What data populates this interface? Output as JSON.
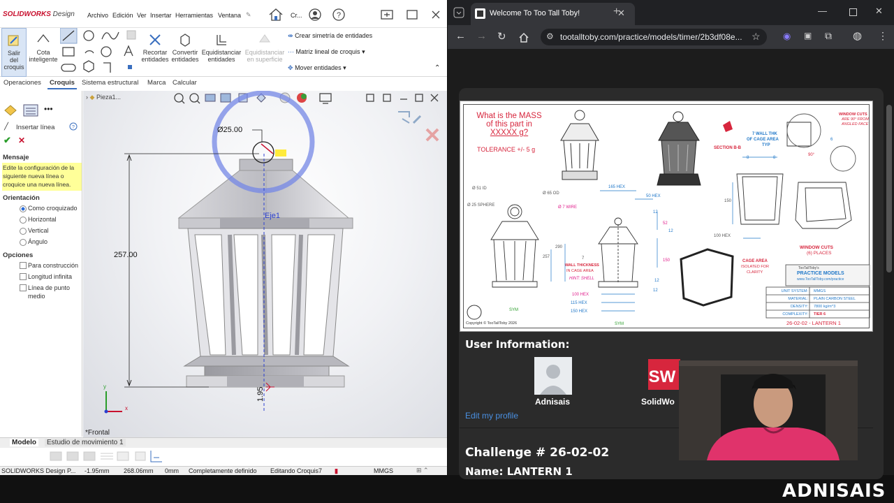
{
  "solidworks": {
    "brand_sw": "SOLIDWORKS",
    "brand_design": "Design",
    "menu": [
      "Archivo",
      "Edición",
      "Ver",
      "Insertar",
      "Herramientas",
      "Ventana"
    ],
    "title_short": "Cr...",
    "ribbon": {
      "exit_sketch": [
        "Salir",
        "del",
        "croquis"
      ],
      "smart_dim": [
        "Cota",
        "inteligente"
      ],
      "trim": [
        "Recortar",
        "entidades"
      ],
      "convert": [
        "Convertir",
        "entidades"
      ],
      "offset": [
        "Equidistanciar",
        "entidades"
      ],
      "offset_surface": [
        "Equidistanciar",
        "en superficie"
      ],
      "mirror": "Crear simetría de entidades",
      "linear_pattern": "Matriz lineal de croquis",
      "move": "Mover entidades"
    },
    "tabs": [
      "Operaciones",
      "Croquis",
      "Sistema estructural",
      "Marca",
      "Calcular"
    ],
    "active_tab": "Croquis",
    "tree_item": "Pieza1...",
    "panel": {
      "title": "Insertar línea",
      "message_header": "Mensaje",
      "message": "Edite la configuración de la siguiente nueva línea o croquice una nueva línea.",
      "orientation_header": "Orientación",
      "orientation": [
        "Como croquizado",
        "Horizontal",
        "Vertical",
        "Ángulo"
      ],
      "orientation_selected": "Como croquizado",
      "options_header": "Opciones",
      "options": [
        "Para construcción",
        "Longitud infinita",
        "Línea de punto medio"
      ]
    },
    "viewport": {
      "dim_diameter": "Ø25.00",
      "dim_height": "257.00",
      "dim_offset": "1.95",
      "axis_label": "Eje1",
      "view_name": "*Frontal",
      "triad_x": "x",
      "triad_y": "y"
    },
    "bottom_tabs": [
      "Modelo",
      "Estudio de movimiento 1"
    ],
    "status": {
      "app": "SOLIDWORKS Design P...",
      "x": "-1.95mm",
      "y": "268.06mm",
      "z": "0mm",
      "state": "Completamente definido",
      "editing": "Editando Croquis7",
      "units": "MMGS"
    }
  },
  "browser": {
    "tab_title": "Welcome To Too Tall Toby!",
    "url": "tootalltoby.com/practice/models/timer/2b3df08e...",
    "drawing": {
      "question": [
        "What is the MASS",
        "of this part in",
        "XXXXX g?"
      ],
      "tolerance": "TOLERANCE +/- 5 g",
      "labels": {
        "id51": "Ø 51 ID",
        "od65": "Ø 65 OD",
        "sphere": "Ø 25 SPHERE",
        "wire": "Ø 7 WIRE",
        "hex165": "165 HEX",
        "hex50": "50 HEX",
        "h290": "290",
        "h257": "257",
        "d7": "7",
        "d12a": "12",
        "d52": "52",
        "d12b": "12",
        "d150": "150",
        "d12c": "12",
        "d12d": "12",
        "wall": "WALL THICKNESS",
        "wall2": "IN CAGE AREA",
        "hint": "HINT: SHELL",
        "hex100": "100 HEX",
        "hex115": "115 HEX",
        "hex150": "150 HEX",
        "sym": "SYM",
        "sec": "SECTION B-B",
        "wallthk": "7 WALL THK",
        "wallthk2": "OF CAGE AREA",
        "typ": "TYP",
        "winc": "WINDOW CUTS",
        "winc2": "ARE 90° FROM",
        "winc3": "ANGLED FACE",
        "a90": "90°",
        "d8a": "8",
        "d8b": "8",
        "d6": "6",
        "hex100b": "100 HEX",
        "d150b": "150",
        "cage": "CAGE AREA",
        "cage2": "ISOLATED FOR",
        "cage3": "CLARITY",
        "wincuts": "WINDOW CUTS",
        "places": "(6) PLACES",
        "copyright": "Copyright © TooTallToby 2026",
        "logo1": "TooTallToby's",
        "logo2": "PRACTICE MODELS",
        "logo3": "www.TooTallToby.com/practice"
      },
      "table": [
        [
          "UNIT SYSTEM:",
          "MMGS"
        ],
        [
          "MATERIAL:",
          "PLAIN CARBON STEEL"
        ],
        [
          "DENSITY:",
          "7800 kg/m^3"
        ],
        [
          "COMPLEXITY:",
          "TIER 6"
        ]
      ],
      "part_id": "26-02-02 - LANTERN 1"
    },
    "user_info_title": "User Information:",
    "user_name": "Adnisais",
    "software_name": "SolidWo",
    "edit_profile": "Edit my profile",
    "challenge": "Challenge # 26-02-02",
    "name_line": "Name: LANTERN 1"
  },
  "brand": "ADNISAIS",
  "colors": {
    "accent_red": "#d7263d",
    "link": "#4a90e2",
    "drawing_blue": "#1f77c8",
    "drawing_magenta": "#e01e8c"
  }
}
